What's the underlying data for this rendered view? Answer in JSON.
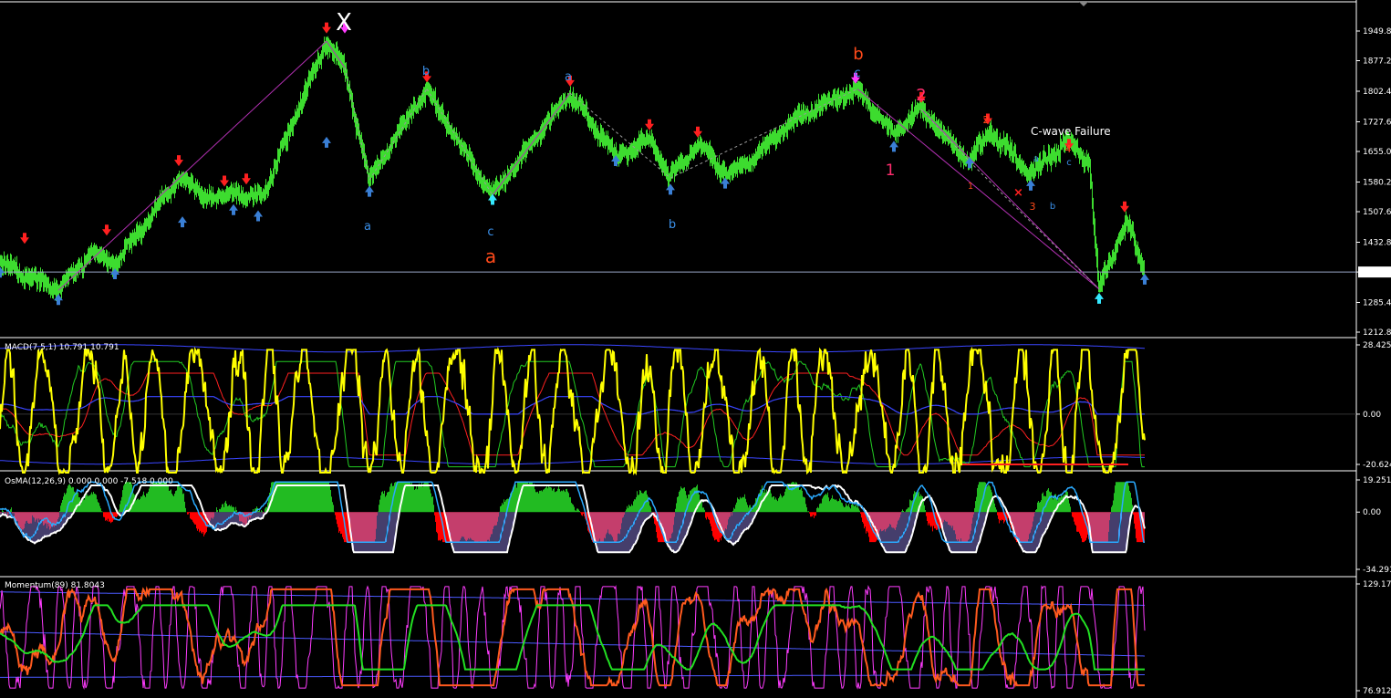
{
  "colors": {
    "background": "#000000",
    "frame": "#ffffff",
    "price_bars": "#3ddc2f",
    "up_arrow": "#3a7fd5",
    "down_arrow": "#ff2020",
    "magenta_arrow": "#ff3cff",
    "cyan_arrow": "#35e8ff",
    "wave_blue": "#3a8fe8",
    "wave_orange": "#ff4a1a",
    "wave_pink": "#ff2d6e",
    "trend_line": "#b030b0",
    "dashed_line": "#999999",
    "current_price_line": "#9aa7c8",
    "macd_main": "#ffff00",
    "macd_signal": "#ff2020",
    "macd_green": "#22cc22",
    "macd_blue": "#3a46ff",
    "macd_band": "#3a46ff",
    "osma_pos": "#22bb22",
    "osma_neg": "#ff0000",
    "osma_hist_violet": "#8a7bd8",
    "osma_line_blue": "#2aaaff",
    "osma_line_white": "#ffffff",
    "mom_orange": "#ff5a1e",
    "mom_magenta": "#ff3cff",
    "mom_green": "#22e022",
    "mom_blue": "#4a5aff"
  },
  "chart_data": [
    {
      "type": "candlestick",
      "panel": "price",
      "y_ticks": [
        "1949.80",
        "1877.20",
        "1802.40",
        "1727.60",
        "1655.00",
        "1580.20",
        "1507.60",
        "1432.80",
        "1359.94",
        "1285.40",
        "1212.80"
      ],
      "ylim": [
        1212.8,
        1949.8
      ],
      "current_price": "1359.94",
      "swing_points": {
        "x_index": [
          0,
          64,
          100,
          126,
          196,
          238,
          256,
          270,
          290,
          358,
          378,
          405,
          468,
          540,
          625,
          678,
          712,
          735,
          765,
          800,
          880,
          940,
          980,
          1010,
          1063,
          1085,
          1130,
          1170,
          1195,
          1205,
          1235,
          1255
        ],
        "price": [
          1382,
          1315,
          1410,
          1378,
          1590,
          1535,
          1560,
          1538,
          1555,
          1925,
          1860,
          1585,
          1808,
          1548,
          1798,
          1640,
          1688,
          1590,
          1675,
          1595,
          1745,
          1808,
          1700,
          1758,
          1630,
          1708,
          1600,
          1680,
          1625,
          1318,
          1485,
          1362
        ]
      },
      "wave_labels": [
        {
          "text": "X",
          "color": "white"
        },
        {
          "text": "b",
          "color": "blue"
        },
        {
          "text": "a",
          "color": "blue"
        },
        {
          "text": "c",
          "color": "blue"
        },
        {
          "text": "a",
          "color": "orange"
        },
        {
          "text": "a",
          "color": "blue"
        },
        {
          "text": "b",
          "color": "blue"
        },
        {
          "text": "b",
          "color": "orange"
        },
        {
          "text": "c",
          "color": "blue"
        },
        {
          "text": "1",
          "color": "pink"
        },
        {
          "text": "2",
          "color": "pink"
        },
        {
          "text": "2",
          "color": "orange"
        },
        {
          "text": "1",
          "color": "orange"
        },
        {
          "text": "3",
          "color": "orange"
        },
        {
          "text": "a",
          "color": "blue"
        },
        {
          "text": "b",
          "color": "blue"
        },
        {
          "text": "4",
          "color": "orange"
        },
        {
          "text": "c",
          "color": "blue"
        }
      ],
      "annotations": [
        "C-wave Failure"
      ]
    },
    {
      "type": "line",
      "panel": "macd",
      "title": "MACD(7,5,1) 10.791 10.791",
      "y_ticks": [
        "28.425",
        "0.00",
        "-20.624"
      ],
      "ylim": [
        -20.624,
        28.425
      ],
      "series": [
        {
          "name": "MACD main"
        },
        {
          "name": "Signal"
        },
        {
          "name": "green"
        },
        {
          "name": "blue"
        }
      ]
    },
    {
      "type": "bar",
      "panel": "osma",
      "title": "OsMA(12,26,9) 0.000 0.000 -7.518 0.000",
      "y_ticks": [
        "19.251",
        "0.00",
        "-34.291"
      ],
      "ylim": [
        -34.291,
        19.251
      ]
    },
    {
      "type": "line",
      "panel": "momentum",
      "title": "Momentum(89) 81.8043",
      "y_ticks": [
        "129.179",
        "76.9123"
      ],
      "ylim": [
        76.9123,
        129.179
      ]
    }
  ]
}
